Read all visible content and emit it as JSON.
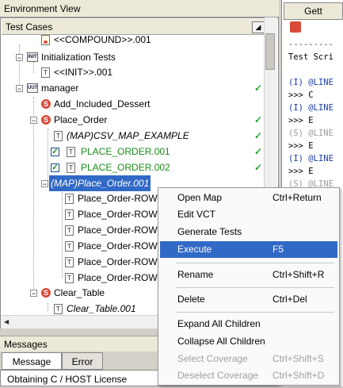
{
  "panels": {
    "environment_view": "Environment View",
    "messages": "Messages"
  },
  "tree": {
    "header": "Test Cases",
    "collapse_button": "◢",
    "rows": [
      {
        "label": "<<COMPOUND>>.001",
        "icon": "test-case-doc-icon"
      },
      {
        "label": "Initialization Tests",
        "icon": "init-folder-icon"
      },
      {
        "label": "<<INIT>>.001",
        "icon": "test-case-icon"
      },
      {
        "label": "manager",
        "icon": "unit-icon",
        "check": "✓"
      },
      {
        "label": "Add_Included_Dessert",
        "icon": "subprogram-icon"
      },
      {
        "label": "Place_Order",
        "icon": "subprogram-icon",
        "check": "✓"
      },
      {
        "label": "(MAP)CSV_MAP_EXAMPLE",
        "icon": "test-case-icon",
        "check": "✓"
      },
      {
        "label": "PLACE_ORDER.001",
        "icon": "test-case-icon",
        "check": "✓",
        "checked": true
      },
      {
        "label": "PLACE_ORDER.002",
        "icon": "test-case-icon",
        "check": "✓",
        "checked": true
      },
      {
        "label": "(MAP)Place_Order.001",
        "icon": "test-case-icon",
        "selected": true
      },
      {
        "label": "Place_Order-ROW",
        "icon": "test-case-icon"
      },
      {
        "label": "Place_Order-ROW",
        "icon": "test-case-icon"
      },
      {
        "label": "Place_Order-ROW",
        "icon": "test-case-icon"
      },
      {
        "label": "Place_Order-ROW",
        "icon": "test-case-icon"
      },
      {
        "label": "Place_Order-ROW",
        "icon": "test-case-icon"
      },
      {
        "label": "Place_Order-ROW",
        "icon": "test-case-icon"
      },
      {
        "label": "Clear_Table",
        "icon": "subprogram-icon"
      },
      {
        "label": "Clear_Table.001",
        "icon": "test-case-icon"
      }
    ]
  },
  "messages": {
    "tabs": [
      "Message",
      "Error"
    ],
    "body": "Obtaining C / HOST License"
  },
  "right_pane": {
    "tab": "Gett",
    "lines": [
      "---------",
      "Test Scri",
      "(I) @LINE",
      "    >>> C",
      "(I) @LINE",
      "    >>> E",
      "(S) @LINE",
      "    >>> E",
      "(I) @LINE",
      "    >>> E",
      "(S) @LINE"
    ]
  },
  "context_menu": {
    "items": [
      {
        "label": "Open Map",
        "shortcut": "Ctrl+Return"
      },
      {
        "label": "Edit VCT",
        "shortcut": ""
      },
      {
        "label": "Generate Tests",
        "shortcut": ""
      },
      {
        "label": "Execute",
        "shortcut": "F5",
        "highlighted": true
      },
      {
        "label": "Rename",
        "shortcut": "Ctrl+Shift+R"
      },
      {
        "label": "Delete",
        "shortcut": "Ctrl+Del"
      },
      {
        "label": "Expand All Children",
        "shortcut": ""
      },
      {
        "label": "Collapse All Children",
        "shortcut": ""
      },
      {
        "label": "Select Coverage",
        "shortcut": "Ctrl+Shift+S",
        "disabled": true
      },
      {
        "label": "Deselect Coverage",
        "shortcut": "Ctrl+Shift+D",
        "disabled": true
      }
    ]
  }
}
